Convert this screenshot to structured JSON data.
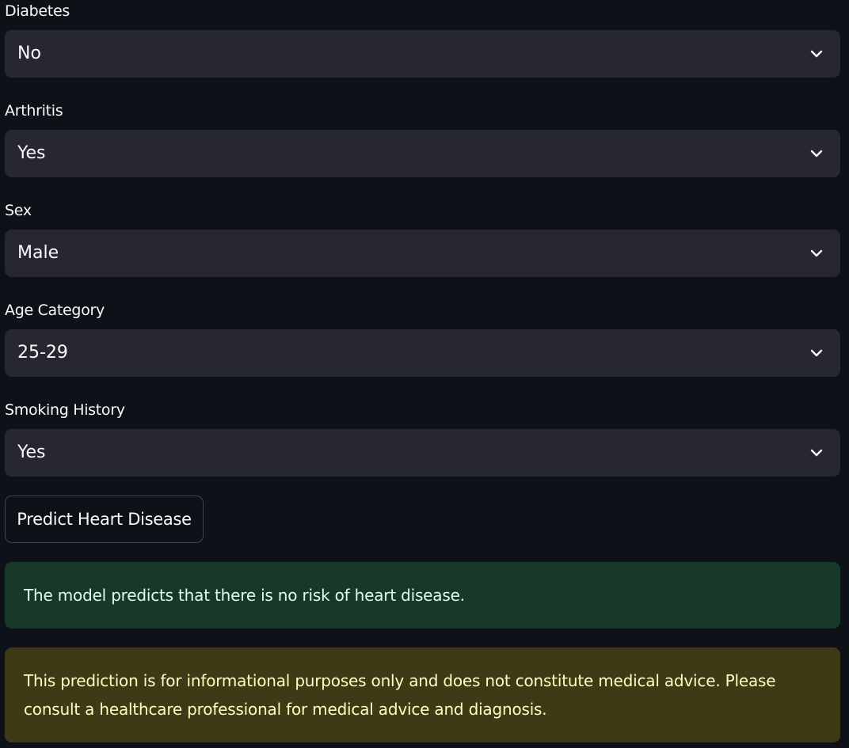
{
  "form": {
    "fields": [
      {
        "label": "Diabetes",
        "value": "No"
      },
      {
        "label": "Arthritis",
        "value": "Yes"
      },
      {
        "label": "Sex",
        "value": "Male"
      },
      {
        "label": "Age Category",
        "value": "25-29"
      },
      {
        "label": "Smoking History",
        "value": "Yes"
      }
    ],
    "submit_label": "Predict Heart Disease"
  },
  "results": {
    "success_message": "The model predicts that there is no risk of heart disease.",
    "warning_message": "This prediction is for informational purposes only and does not constitute medical advice. Please consult a healthcare professional for medical advice and diagnosis."
  },
  "icons": {
    "dropdown": "chevron-down-icon"
  },
  "colors": {
    "background": "#0e1117",
    "select_background": "#262730",
    "success_background": "#173928",
    "success_text": "#dffde9",
    "warning_background": "#3e3a16",
    "warning_text": "#ffffc2"
  }
}
